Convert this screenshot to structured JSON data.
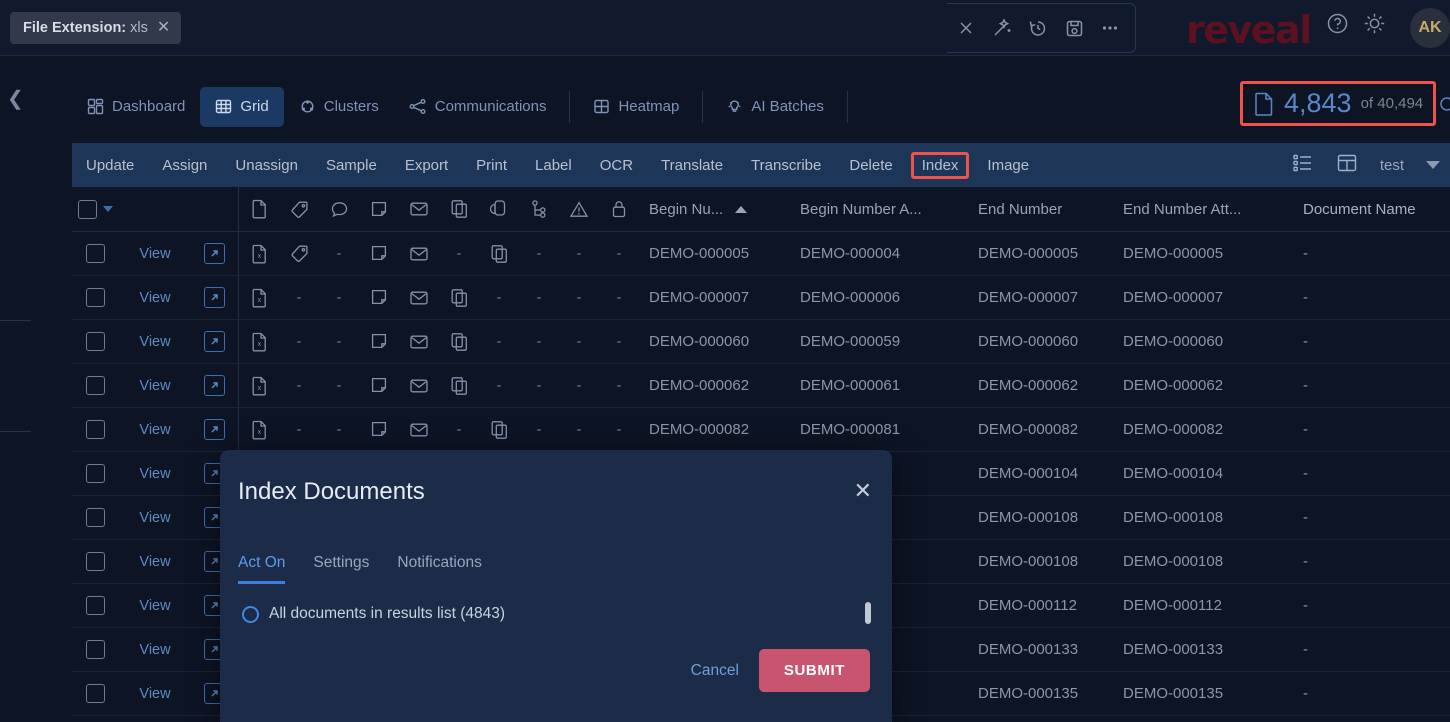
{
  "topbar": {
    "filter_chip": {
      "key": "File Extension:",
      "value": "xls",
      "close": "✕"
    },
    "actions": [
      {
        "name": "close-icon",
        "label": "Close"
      },
      {
        "name": "magic-wand-icon",
        "label": "Magic"
      },
      {
        "name": "history-icon",
        "label": "History"
      },
      {
        "name": "save-icon",
        "label": "Save"
      },
      {
        "name": "more-icon",
        "label": "More"
      }
    ],
    "brand": "reveal",
    "help_icon": "help-icon",
    "theme_icon": "brightness-icon",
    "avatar": "AK"
  },
  "nav": {
    "tabs": [
      {
        "label": "Dashboard",
        "icon": "dashboard-icon",
        "active": false
      },
      {
        "label": "Grid",
        "icon": "grid-icon",
        "active": true
      },
      {
        "label": "Clusters",
        "icon": "clusters-icon",
        "active": false
      },
      {
        "label": "Communications",
        "icon": "communications-icon",
        "active": false
      },
      {
        "label": "Heatmap",
        "icon": "heatmap-icon",
        "active": false
      },
      {
        "label": "AI Batches",
        "icon": "lightbulb-icon",
        "active": false
      }
    ]
  },
  "counter": {
    "count": "4,843",
    "of": "of 40,494",
    "highlighted": true,
    "highlight_color": "#f0524a"
  },
  "toolbar": {
    "items": [
      {
        "label": "Update",
        "boxed": false
      },
      {
        "label": "Assign",
        "boxed": false
      },
      {
        "label": "Unassign",
        "boxed": false
      },
      {
        "label": "Sample",
        "boxed": false
      },
      {
        "label": "Export",
        "boxed": false
      },
      {
        "label": "Print",
        "boxed": false
      },
      {
        "label": "Label",
        "boxed": false
      },
      {
        "label": "OCR",
        "boxed": false
      },
      {
        "label": "Translate",
        "boxed": false
      },
      {
        "label": "Transcribe",
        "boxed": false
      },
      {
        "label": "Delete",
        "boxed": false
      },
      {
        "label": "Index",
        "boxed": true
      },
      {
        "label": "Image",
        "boxed": false
      }
    ],
    "view_name": "test",
    "right_icons": [
      "list-view-icon",
      "layout-icon"
    ]
  },
  "grid": {
    "icon_columns": [
      "document-icon",
      "tag-icon",
      "comment-icon",
      "note-icon",
      "envelope-icon",
      "copy-icon",
      "paperclip-icon",
      "family-tree-icon",
      "warning-icon",
      "lock-icon"
    ],
    "columns": [
      {
        "label": "Begin Nu...",
        "sort": "asc"
      },
      {
        "label": "Begin Number A...",
        "sort": ""
      },
      {
        "label": "End Number",
        "sort": ""
      },
      {
        "label": "End Number Att...",
        "sort": ""
      },
      {
        "label": "Document Name",
        "sort": ""
      }
    ],
    "view_label": "View",
    "rows": [
      {
        "icons": [
          "xls-file-icon",
          "tag-icon",
          "-",
          "note-icon",
          "envelope-icon",
          "-",
          "copy-icon",
          "-",
          "-",
          "-"
        ],
        "begin_number": "DEMO-000005",
        "begin_number_att": "DEMO-000004",
        "end_number": "DEMO-000005",
        "end_number_att": "DEMO-000005",
        "document_name": "-"
      },
      {
        "icons": [
          "xls-file-icon",
          "-",
          "-",
          "note-icon",
          "envelope-icon",
          "copy-icon",
          "-",
          "-",
          "-",
          "-"
        ],
        "begin_number": "DEMO-000007",
        "begin_number_att": "DEMO-000006",
        "end_number": "DEMO-000007",
        "end_number_att": "DEMO-000007",
        "document_name": "-"
      },
      {
        "icons": [
          "xls-file-icon",
          "-",
          "-",
          "note-icon",
          "envelope-icon",
          "copy-icon",
          "-",
          "-",
          "-",
          "-"
        ],
        "begin_number": "DEMO-000060",
        "begin_number_att": "DEMO-000059",
        "end_number": "DEMO-000060",
        "end_number_att": "DEMO-000060",
        "document_name": "-"
      },
      {
        "icons": [
          "xls-file-icon",
          "-",
          "-",
          "note-icon",
          "envelope-icon",
          "copy-icon",
          "-",
          "-",
          "-",
          "-"
        ],
        "begin_number": "DEMO-000062",
        "begin_number_att": "DEMO-000061",
        "end_number": "DEMO-000062",
        "end_number_att": "DEMO-000062",
        "document_name": "-"
      },
      {
        "icons": [
          "xls-file-icon",
          "-",
          "-",
          "note-icon",
          "envelope-icon",
          "-",
          "copy-icon",
          "-",
          "-",
          "-"
        ],
        "begin_number": "DEMO-000082",
        "begin_number_att": "DEMO-000081",
        "end_number": "DEMO-000082",
        "end_number_att": "DEMO-000082",
        "document_name": "-"
      },
      {
        "icons": [
          "xls-file-icon",
          "-",
          "-",
          "note-icon",
          "envelope-icon",
          "-",
          "copy-icon",
          "-",
          "-",
          "-"
        ],
        "begin_number": "",
        "begin_number_att": "",
        "end_number": "DEMO-000104",
        "end_number_att": "DEMO-000104",
        "document_name": "-"
      },
      {
        "icons": [
          "xls-file-icon",
          "-",
          "-",
          "note-icon",
          "envelope-icon",
          "-",
          "copy-icon",
          "-",
          "-",
          "-"
        ],
        "begin_number": "",
        "begin_number_att": "",
        "end_number": "DEMO-000108",
        "end_number_att": "DEMO-000108",
        "document_name": "-"
      },
      {
        "icons": [
          "xls-file-icon",
          "-",
          "-",
          "note-icon",
          "envelope-icon",
          "-",
          "copy-icon",
          "-",
          "-",
          "-"
        ],
        "begin_number": "",
        "begin_number_att": "",
        "end_number": "DEMO-000108",
        "end_number_att": "DEMO-000108",
        "document_name": "-"
      },
      {
        "icons": [
          "xls-file-icon",
          "-",
          "-",
          "note-icon",
          "envelope-icon",
          "-",
          "copy-icon",
          "-",
          "-",
          "-"
        ],
        "begin_number": "",
        "begin_number_att": "",
        "end_number": "DEMO-000112",
        "end_number_att": "DEMO-000112",
        "document_name": "-"
      },
      {
        "icons": [
          "xls-file-icon",
          "-",
          "-",
          "note-icon",
          "envelope-icon",
          "-",
          "copy-icon",
          "-",
          "-",
          "-"
        ],
        "begin_number": "",
        "begin_number_att": "",
        "end_number": "DEMO-000133",
        "end_number_att": "DEMO-000133",
        "document_name": "-"
      },
      {
        "icons": [
          "xls-file-icon",
          "-",
          "-",
          "note-icon",
          "envelope-icon",
          "-",
          "copy-icon",
          "-",
          "-",
          "-"
        ],
        "begin_number": "",
        "begin_number_att": "",
        "end_number": "DEMO-000135",
        "end_number_att": "DEMO-000135",
        "document_name": "-"
      }
    ]
  },
  "modal": {
    "title": "Index Documents",
    "close": "✕",
    "tabs": [
      {
        "label": "Act On",
        "active": true
      },
      {
        "label": "Settings",
        "active": false
      },
      {
        "label": "Notifications",
        "active": false
      }
    ],
    "option_label": "All documents in results list (4843)",
    "cancel_label": "Cancel",
    "submit_label": "SUBMIT",
    "submit_color": "#c9546f"
  }
}
